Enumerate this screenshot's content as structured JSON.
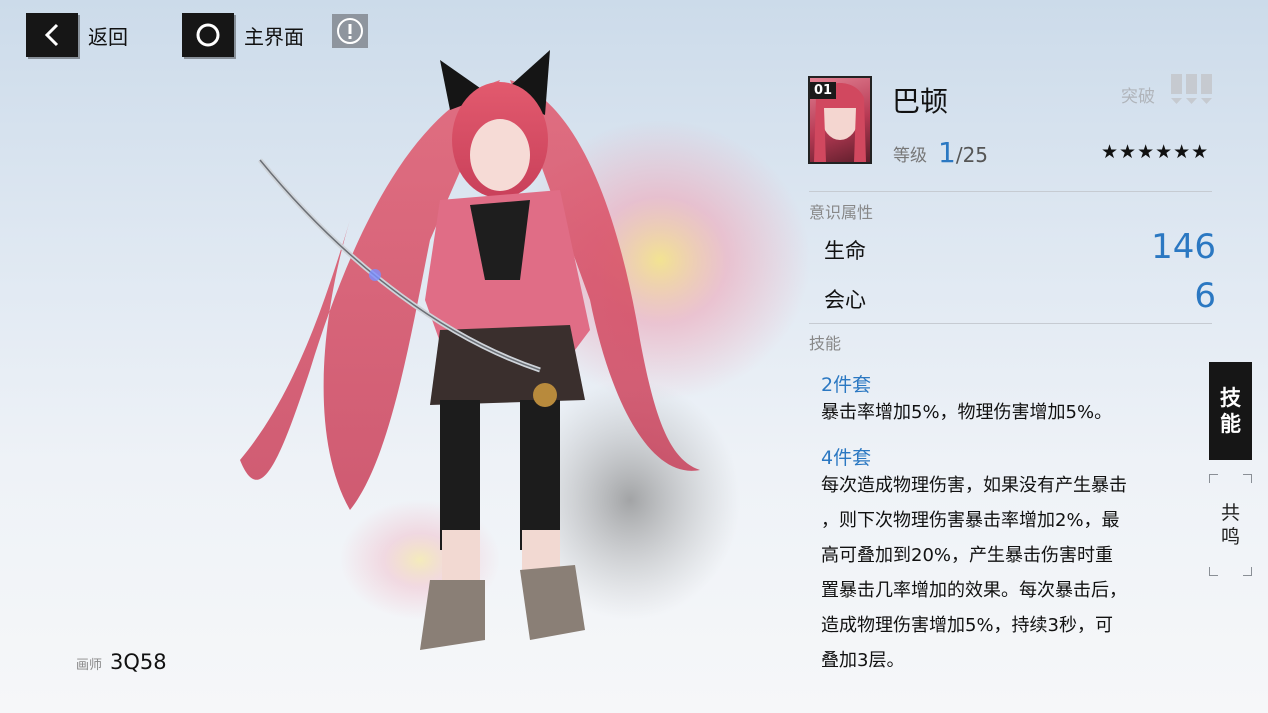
{
  "nav": {
    "back_label": "返回",
    "home_label": "主界面",
    "info_icon": "exclamation-circle-icon"
  },
  "artist": {
    "label": "画师",
    "name": "3Q58"
  },
  "character": {
    "slot_number": "01",
    "name": "巴顿",
    "level_label": "等级",
    "level_current": "1",
    "level_max": "/25",
    "breakthrough_label": "突破",
    "breakthrough_level": 0,
    "breakthrough_max": 3,
    "stars": "★★★★★★"
  },
  "attributes": {
    "section_title": "意识属性",
    "items": [
      {
        "name": "生命",
        "value": "146"
      },
      {
        "name": "会心",
        "value": "6"
      }
    ]
  },
  "skills": {
    "section_title": "技能",
    "sets": [
      {
        "title": "2件套",
        "lines": [
          "暴击率增加5%，物理伤害增加5%。"
        ]
      },
      {
        "title": "4件套",
        "lines": [
          "每次造成物理伤害，如果没有产生暴击",
          "，则下次物理伤害暴击率增加2%，最",
          "高可叠加到20%，产生暴击伤害时重",
          "置暴击几率增加的效果。每次暴击后，",
          "造成物理伤害增加5%，持续3秒，可",
          "叠加3层。"
        ]
      }
    ]
  },
  "side_tabs": {
    "skills_char1": "技",
    "skills_char2": "能",
    "resonance_char1": "共",
    "resonance_char2": "鸣"
  },
  "colors": {
    "accent": "#2b78c2",
    "dark": "#161616",
    "hair": "#e0566c"
  }
}
